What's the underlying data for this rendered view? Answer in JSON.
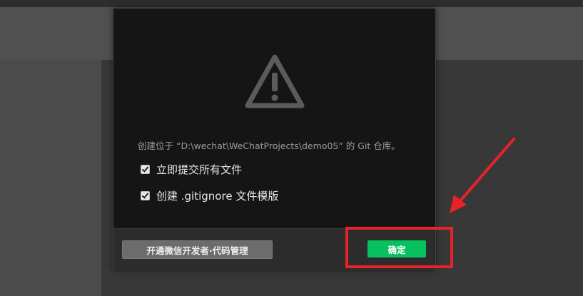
{
  "dialog": {
    "message": "创建位于 “D:\\wechat\\WeChatProjects\\demo05” 的 Git 仓库。",
    "options": [
      {
        "label": "立即提交所有文件",
        "checked": true
      },
      {
        "label": "创建 .gitignore 文件模版",
        "checked": true
      }
    ],
    "footer": {
      "open_button_label": "开通微信开发者·代码管理",
      "confirm_button_label": "确定"
    }
  },
  "colors": {
    "accent": "#07c160",
    "annotation": "#e8212b",
    "icon": "#5b5b5b"
  },
  "icons": {
    "warning": "warning-icon",
    "arrow": "annotation-arrow"
  }
}
